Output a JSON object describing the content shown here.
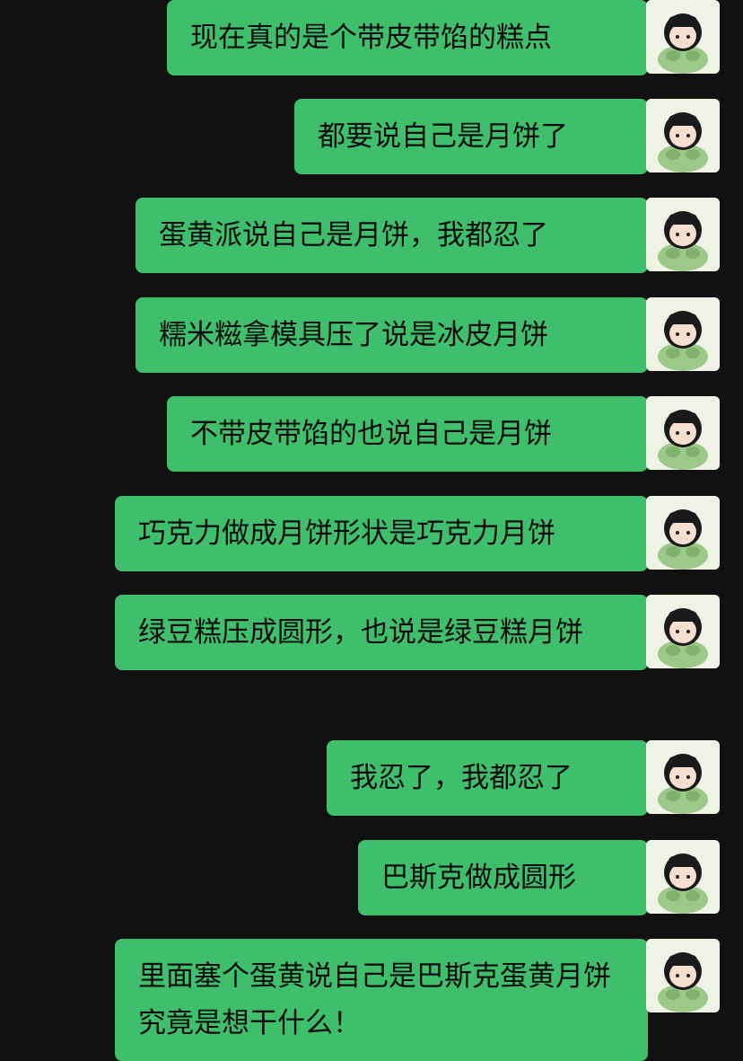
{
  "messages": [
    {
      "text": "现在真的是个带皮带馅的糕点"
    },
    {
      "text": "都要说自己是月饼了"
    },
    {
      "text": "蛋黄派说自己是月饼，我都忍了"
    },
    {
      "text": "糯米糍拿模具压了说是冰皮月饼"
    },
    {
      "text": "不带皮带馅的也说自己是月饼"
    },
    {
      "text": "巧克力做成月饼形状是巧克力月饼"
    },
    {
      "text": "绿豆糕压成圆形，也说是绿豆糕月饼"
    },
    {
      "text": "我忍了，我都忍了"
    },
    {
      "text": "巴斯克做成圆形"
    },
    {
      "text": "里面塞个蛋黄说自己是巴斯克蛋黄月饼究竟是想干什么！"
    }
  ],
  "colors": {
    "background": "#111111",
    "bubble": "#3fbf6b",
    "text": "#0c0c0c"
  },
  "icons": {
    "avatar": "user-avatar"
  }
}
